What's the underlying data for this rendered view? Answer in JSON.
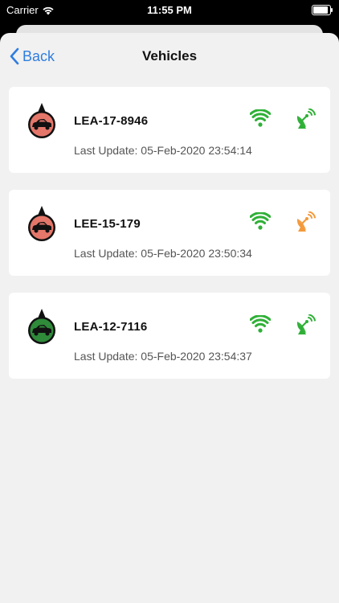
{
  "status": {
    "carrier": "Carrier",
    "time": "11:55 PM"
  },
  "nav": {
    "back_label": "Back",
    "title": "Vehicles"
  },
  "vehicles": [
    {
      "plate": "LEA-17-8946",
      "update_prefix": "Last Update:",
      "update_time": "05-Feb-2020 23:54:14",
      "status_color": "#e4776a",
      "wifi_color": "#2fb037",
      "satellite_color": "#2fb037"
    },
    {
      "plate": "LEE-15-179",
      "update_prefix": "Last Update:",
      "update_time": "05-Feb-2020 23:50:34",
      "status_color": "#e4776a",
      "wifi_color": "#2fb037",
      "satellite_color": "#f39a3b"
    },
    {
      "plate": "LEA-12-7116",
      "update_prefix": "Last Update:",
      "update_time": "05-Feb-2020 23:54:37",
      "status_color": "#2f8a3a",
      "wifi_color": "#2fb037",
      "satellite_color": "#2fb037"
    }
  ]
}
